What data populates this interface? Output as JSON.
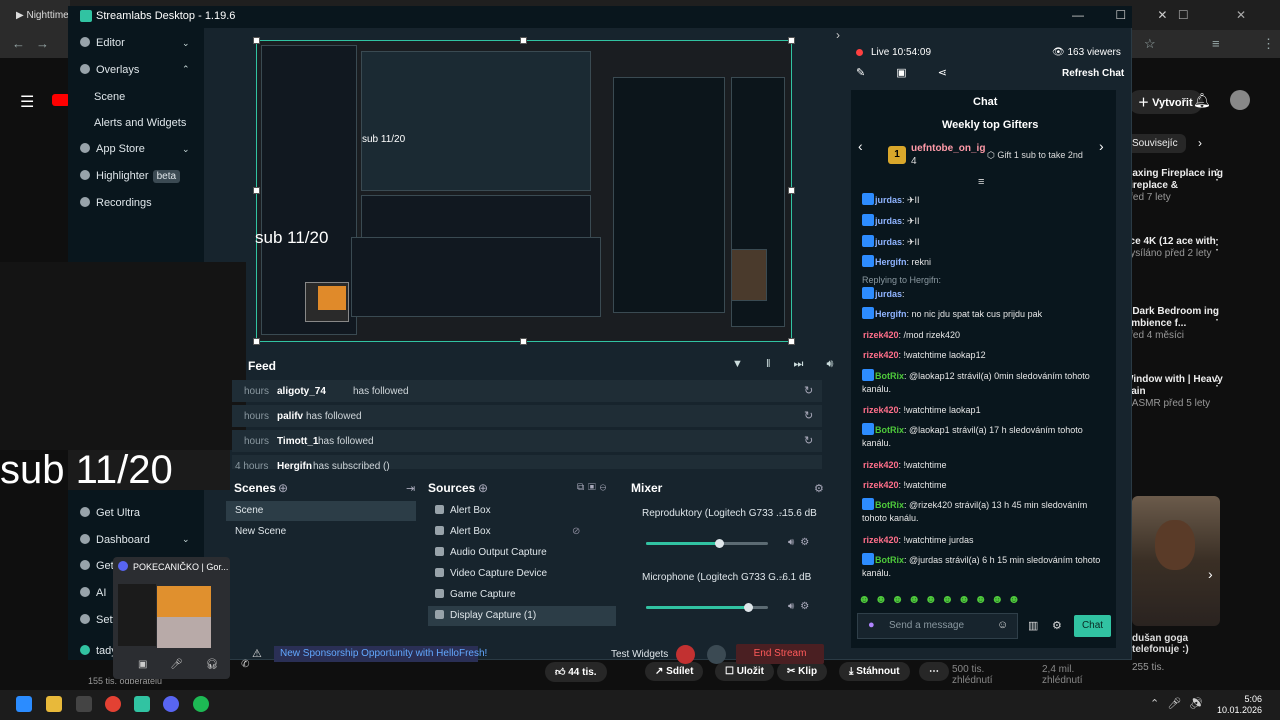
{
  "browser": {
    "tab_title": "Nighttime",
    "yt_create": "Vytvořit",
    "chip": "Souvisejíc",
    "recommendations": [
      {
        "title": "elaxing Fireplace ing Fireplace &",
        "meta": "před 7 lety"
      },
      {
        "title": "ace 4K (12 ace with",
        "meta": "Vysíláno před 2 lety"
      },
      {
        "title": "a Dark Bedroom ing Ambience f...",
        "meta": "před 4 měsíci"
      },
      {
        "title": "Window with | Heavy Rain",
        "meta": "e ASMR před 5 lety"
      }
    ],
    "video_title": "dušan goga telefonuje :)",
    "video_views": "255 tis.",
    "left_views": "155 tis. odběratelů",
    "actions": {
      "likes": "44 tis.",
      "share": "Sdílet",
      "save": "Uložit",
      "clip": "Klip",
      "download": "Stáhnout"
    },
    "views_a": "500 tis. zhlédnutí",
    "views_b": "2,4 mil. zhlédnutí",
    "clock_time": "5:06",
    "clock_date": "10.01.2026"
  },
  "streamlabs": {
    "title": "Streamlabs Desktop - 1.19.6",
    "nav": {
      "editor": "Editor",
      "overlays": "Overlays",
      "scene": "Scene",
      "alerts": "Alerts and Widgets",
      "app_store": "App Store",
      "highlighter": "Highlighter",
      "beta": "beta",
      "recordings": "Recordings",
      "get_ultra": "Get Ultra",
      "dashboard": "Dashboard",
      "get": "Get",
      "ai": "AI",
      "settings": "Sett",
      "tady": "tady"
    },
    "overlay_sub_big": "sub 11/20",
    "overlay_sub_small": "sub 11/20",
    "overlay_sub_mini": "sub 11/20",
    "feed": {
      "title": "Feed",
      "rows": [
        {
          "time": "hours",
          "name": "aligoty_74",
          "action": "has followed"
        },
        {
          "time": "hours",
          "name": "palifv",
          "action": "has followed"
        },
        {
          "time": "hours",
          "name": "Timott_1",
          "action": "has followed"
        },
        {
          "time": "4 hours",
          "name": "Hergifn",
          "action": "has subscribed ()"
        }
      ]
    },
    "scenes": {
      "title": "Scenes",
      "items": [
        "Scene",
        "New Scene"
      ]
    },
    "sources": {
      "title": "Sources",
      "items": [
        "Alert Box",
        "Alert Box",
        "Audio Output Capture",
        "Video Capture Device",
        "Game Capture",
        "Display Capture (1)"
      ]
    },
    "mixer": {
      "title": "Mixer",
      "channels": [
        {
          "name": "Reproduktory (Logitech G733 ...",
          "db": "-15.6 dB",
          "level": 0.6
        },
        {
          "name": "Microphone (Logitech G733 G...",
          "db": "-6.1 dB",
          "level": 0.84
        }
      ]
    },
    "footer": {
      "sponsor": "New Sponsorship Opportunity with HelloFresh!",
      "test_widgets": "Test Widgets",
      "end_stream": "End Stream"
    },
    "live": {
      "status": "Live 10:54:09",
      "viewers": "163 viewers",
      "refresh": "Refresh Chat"
    }
  },
  "chat": {
    "header": "Chat",
    "gifters_title": "Weekly top Gifters",
    "top_gifter": {
      "rank": "1",
      "name": "uefntobe_on_ig",
      "count": "4"
    },
    "gift_cta": "Gift 1 sub to take 2nd",
    "messages": [
      {
        "user": "jurdas",
        "color": "#8fb4ff",
        "text": ": ✈II"
      },
      {
        "user": "jurdas",
        "color": "#8fb4ff",
        "text": ": ✈II"
      },
      {
        "user": "jurdas",
        "color": "#8fb4ff",
        "text": ": ✈II"
      },
      {
        "user": "Hergifn",
        "color": "#8fb4ff",
        "text": ": rekni"
      },
      {
        "user": "",
        "color": "#8a98a0",
        "text": "Replying to Hergifn:"
      },
      {
        "user": "jurdas",
        "color": "#8fb4ff",
        "text": ":"
      },
      {
        "user": "Hergifn",
        "color": "#8fb4ff",
        "text": ": no nic jdu spat tak cus prijdu pak"
      },
      {
        "user": "rizek420",
        "color": "#ff6f8a",
        "text": ": /mod rizek420"
      },
      {
        "user": "rizek420",
        "color": "#ff6f8a",
        "text": ": !watchtime laokap12"
      },
      {
        "user": "BotRix",
        "color": "#4ec93b",
        "text": ": @laokap12 strávil(a) 0min sledováním tohoto kanálu."
      },
      {
        "user": "rizek420",
        "color": "#ff6f8a",
        "text": ": !watchtime laokap1"
      },
      {
        "user": "BotRix",
        "color": "#4ec93b",
        "text": ": @laokap1 strávil(a) 17 h sledováním tohoto kanálu."
      },
      {
        "user": "rizek420",
        "color": "#ff6f8a",
        "text": ": !watchtime"
      },
      {
        "user": "rizek420",
        "color": "#ff6f8a",
        "text": ": !watchtime"
      },
      {
        "user": "BotRix",
        "color": "#4ec93b",
        "text": ": @rizek420 strávil(a) 13 h 45 min sledováním tohoto kanálu."
      },
      {
        "user": "rizek420",
        "color": "#ff6f8a",
        "text": ": !watchtime jurdas"
      },
      {
        "user": "BotRix",
        "color": "#4ec93b",
        "text": ": @jurdas strávil(a) 6 h 15 min sledováním tohoto kanálu."
      }
    ],
    "input_placeholder": "Send a message",
    "send_label": "Chat"
  },
  "discord_popup": {
    "title": "POKECANIČKO | Gor..."
  }
}
